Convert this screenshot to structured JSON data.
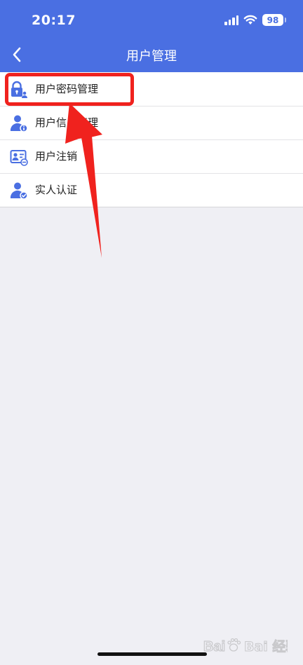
{
  "status_bar": {
    "time": "20:17",
    "battery": "98"
  },
  "header": {
    "title": "用户管理",
    "back_icon": "chevron-left-icon"
  },
  "menu": {
    "items": [
      {
        "label": "用户密码管理",
        "icon": "lock-user-icon"
      },
      {
        "label": "用户信息管理",
        "icon": "user-info-icon"
      },
      {
        "label": "用户注销",
        "icon": "user-card-icon"
      },
      {
        "label": "实人认证",
        "icon": "user-verify-icon"
      }
    ]
  },
  "annotation": {
    "highlight_color": "#f0221e",
    "arrow_color": "#f0221e"
  },
  "watermark": {
    "text": "Bai 经验",
    "logo": "baidu-paw-logo"
  },
  "colors": {
    "header_bg": "#4a6fe2",
    "page_bg": "#efeff4",
    "icon_blue": "#4a6fe2"
  }
}
